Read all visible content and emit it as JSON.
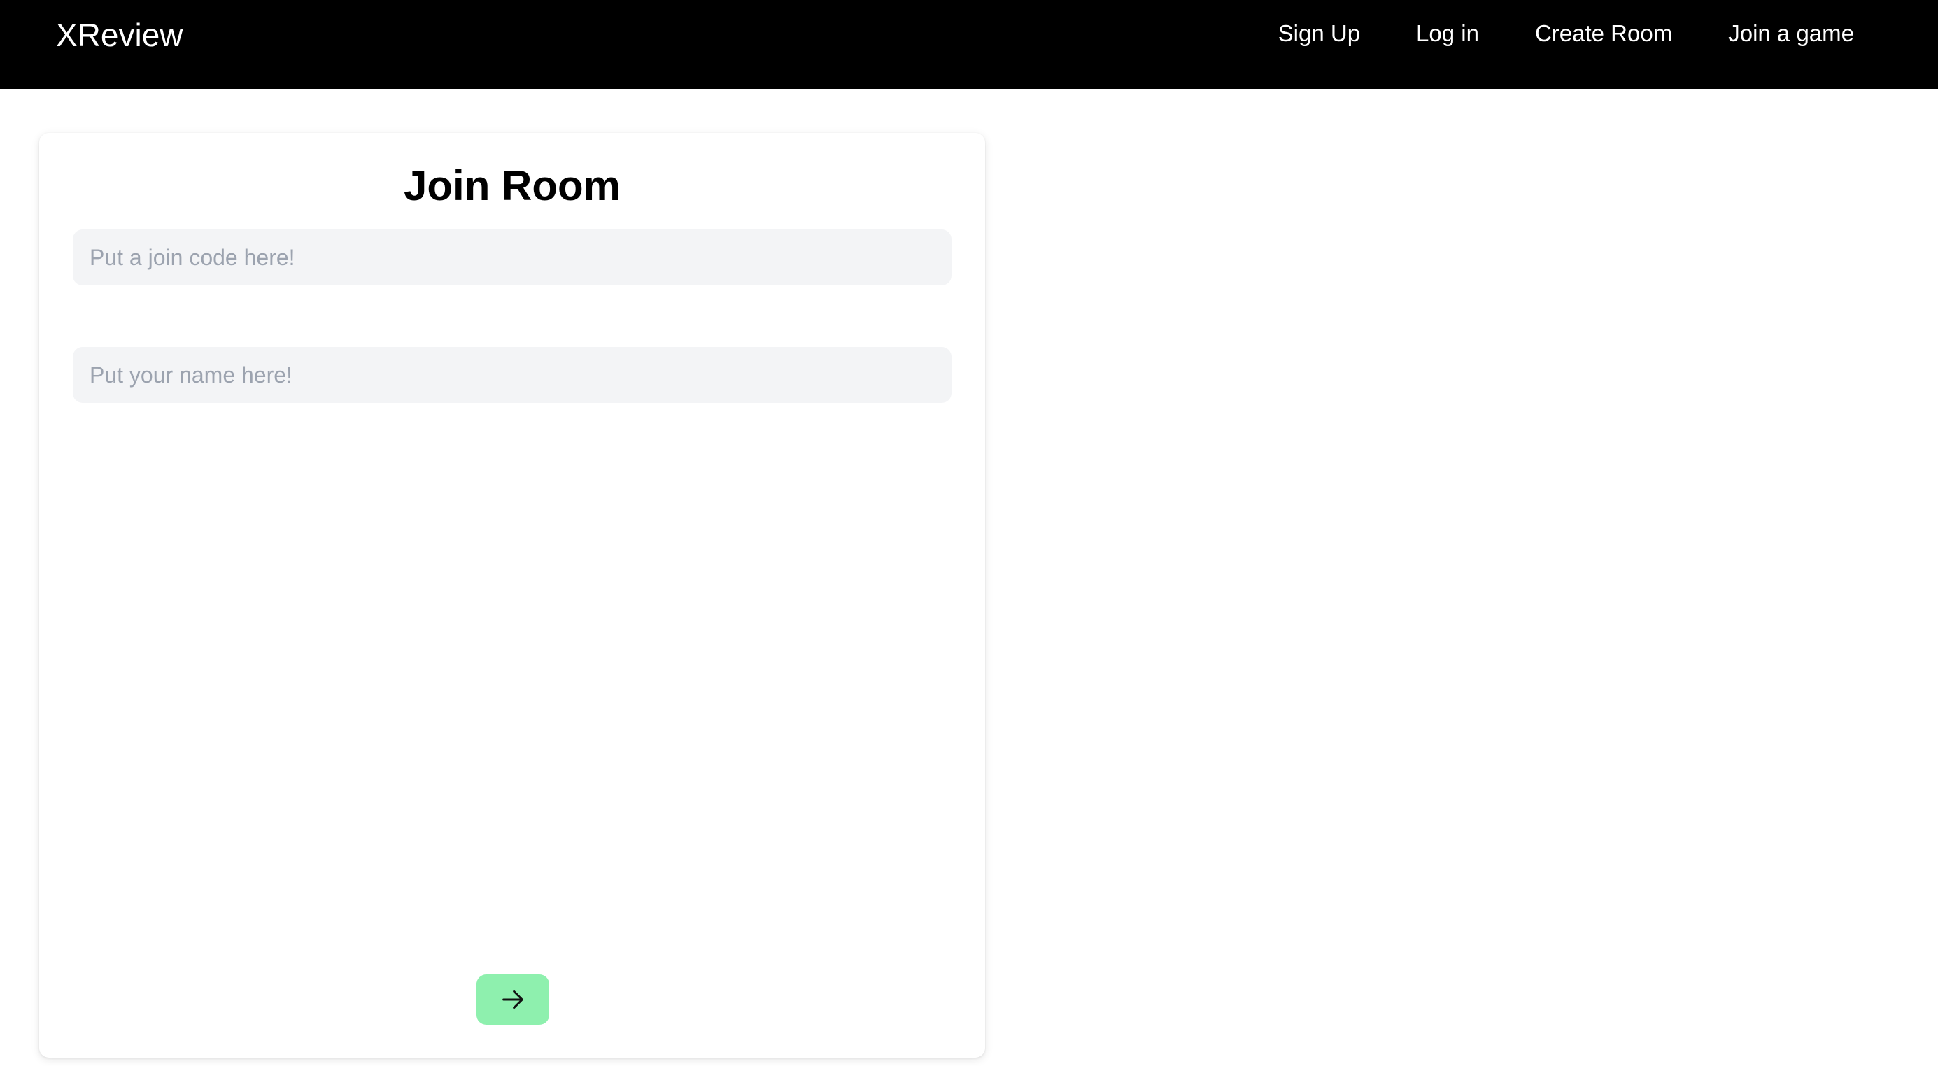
{
  "navbar": {
    "brand": "XReview",
    "links": [
      {
        "label": "Sign Up"
      },
      {
        "label": "Log in"
      },
      {
        "label": "Create Room"
      },
      {
        "label": "Join a game"
      }
    ]
  },
  "join_room": {
    "title": "Join Room",
    "join_code": {
      "value": "",
      "placeholder": "Put a join code here!"
    },
    "name": {
      "value": "",
      "placeholder": "Put your name here!"
    },
    "submit_icon": "arrow-right-icon"
  },
  "colors": {
    "navbar_bg": "#000000",
    "submit_bg": "#8ef0ae",
    "input_bg": "#f3f4f6"
  }
}
